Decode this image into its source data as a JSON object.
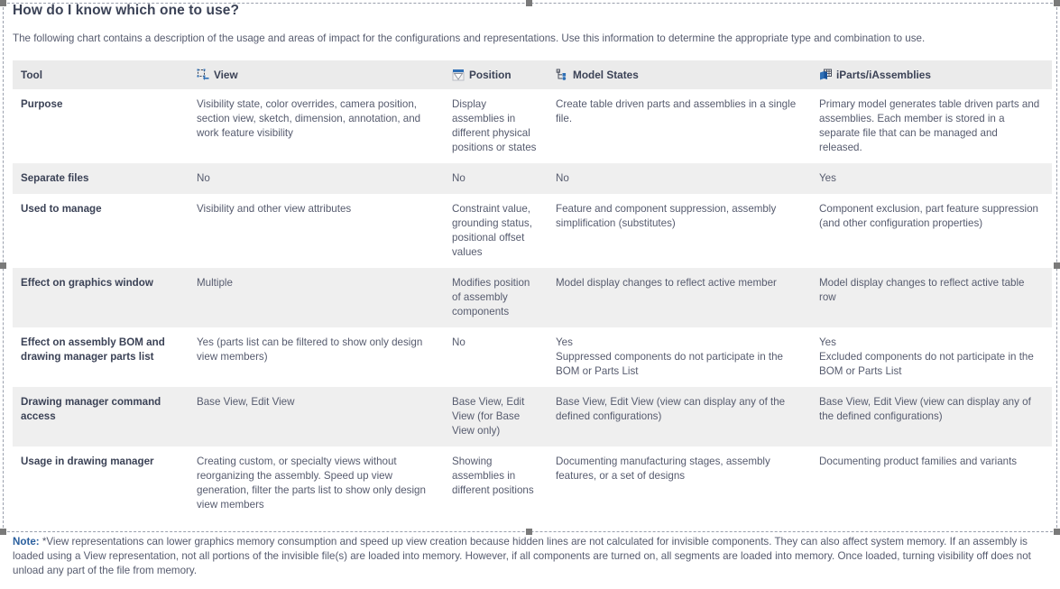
{
  "page": {
    "title": "How do I know which one to use?",
    "intro": "The following chart contains a description of the usage and areas of impact for the configurations and representations. Use this information to determine the appropriate type and combination to use."
  },
  "table": {
    "headers": [
      {
        "label": "Tool",
        "icon": ""
      },
      {
        "label": "View",
        "icon": "view-representation-icon"
      },
      {
        "label": "Position",
        "icon": "positional-representation-icon"
      },
      {
        "label": "Model States",
        "icon": "model-states-icon"
      },
      {
        "label": "iParts/iAssemblies",
        "icon": "iparts-iassemblies-icon"
      }
    ],
    "rows": [
      {
        "shaded": false,
        "cells": [
          "Purpose",
          "Visibility state, color overrides, camera position, section view, sketch, dimension, annotation, and work feature visibility",
          "Display assemblies in different physical positions or states",
          "Create table driven parts and assemblies in a single file.",
          "Primary model generates table driven parts and assemblies. Each member is stored in a separate file that can be managed and released."
        ]
      },
      {
        "shaded": true,
        "cells": [
          "Separate files",
          "No",
          "No",
          "No",
          "Yes"
        ]
      },
      {
        "shaded": false,
        "cells": [
          "Used to manage",
          "Visibility and other view attributes",
          "Constraint value, grounding status, positional offset values",
          "Feature and component suppression, assembly simplification (substitutes)",
          "Component exclusion, part feature suppression (and other configuration properties)"
        ]
      },
      {
        "shaded": true,
        "cells": [
          "Effect on graphics window",
          "Multiple",
          "Modifies position of assembly components",
          "Model display changes to reflect active member",
          "Model display changes to reflect active table row"
        ]
      },
      {
        "shaded": false,
        "cells": [
          "Effect on assembly BOM and drawing manager parts list",
          "Yes (parts list can be filtered to show only design view members)",
          "No",
          "Yes\nSuppressed components do not participate in the BOM or Parts List",
          "Yes\nExcluded components do not participate in the BOM or Parts List"
        ]
      },
      {
        "shaded": true,
        "cells": [
          "Drawing manager command access",
          "Base View, Edit View",
          "Base View, Edit View (for Base View only)",
          "Base View, Edit View (view can display any of the defined configurations)",
          "Base View, Edit View (view can display any of the defined configurations)"
        ]
      },
      {
        "shaded": false,
        "cells": [
          "Usage in drawing manager",
          "Creating custom, or specialty views without reorganizing the assembly. Speed up view generation, filter the parts list to show only design view members",
          "Showing assemblies in different positions",
          "Documenting manufacturing stages, assembly features, or a set of designs",
          "Documenting product families and variants"
        ]
      }
    ]
  },
  "note": {
    "label": "Note:",
    "text": "*View representations can lower graphics memory consumption and speed up view creation because hidden lines are not calculated for invisible components. They can also affect system memory. If an assembly is loaded using a View representation, not all portions of the invisible file(s) are loaded into memory. However, if all components are turned on, all segments are loaded into memory. Once loaded, turning visibility off does not unload any part of the file from memory."
  },
  "colors": {
    "header_bg": "#ebebeb",
    "row_shaded_bg": "#efefef",
    "heading_text": "#3b4256",
    "body_text": "#565b6e",
    "note_label": "#2b5f9e",
    "icon_blue": "#2f6fb5",
    "selection_border": "#9aa0ad",
    "selection_handle": "#7a7a7a"
  }
}
